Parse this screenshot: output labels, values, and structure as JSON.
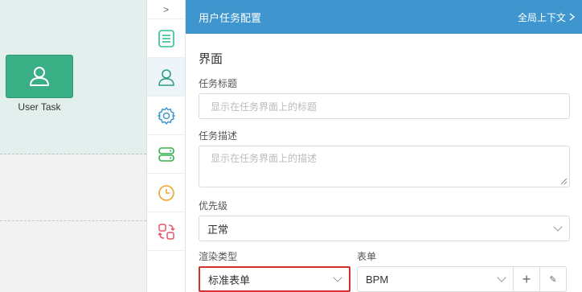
{
  "canvas": {
    "task_label": "User Task"
  },
  "strip": {
    "toggle_glyph": ">",
    "items": [
      {
        "name": "list-icon",
        "color": "#2bbf95"
      },
      {
        "name": "user-icon",
        "color": "#2b9f7f"
      },
      {
        "name": "gear-icon",
        "color": "#3f96cf"
      },
      {
        "name": "server-icon",
        "color": "#32b34e"
      },
      {
        "name": "clock-icon",
        "color": "#f0a330"
      },
      {
        "name": "sync-icon",
        "color": "#e8536a"
      }
    ]
  },
  "panel": {
    "title": "用户任务配置",
    "context_link": "全局上下文",
    "section_title": "界面",
    "task_title_label": "任务标题",
    "task_title_placeholder": "显示在任务界面上的标题",
    "task_desc_label": "任务描述",
    "task_desc_placeholder": "显示在任务界面上的描述",
    "priority_label": "优先级",
    "priority_value": "正常",
    "render_type_label": "渲染类型",
    "render_type_value": "标准表单",
    "form_label": "表单",
    "form_value": "BPM",
    "add_glyph": "+",
    "edit_glyph": "✎"
  },
  "colors": {
    "header_bg": "#3f96cf",
    "task_green": "#3aaf85",
    "highlight_red": "#d32f2f"
  }
}
